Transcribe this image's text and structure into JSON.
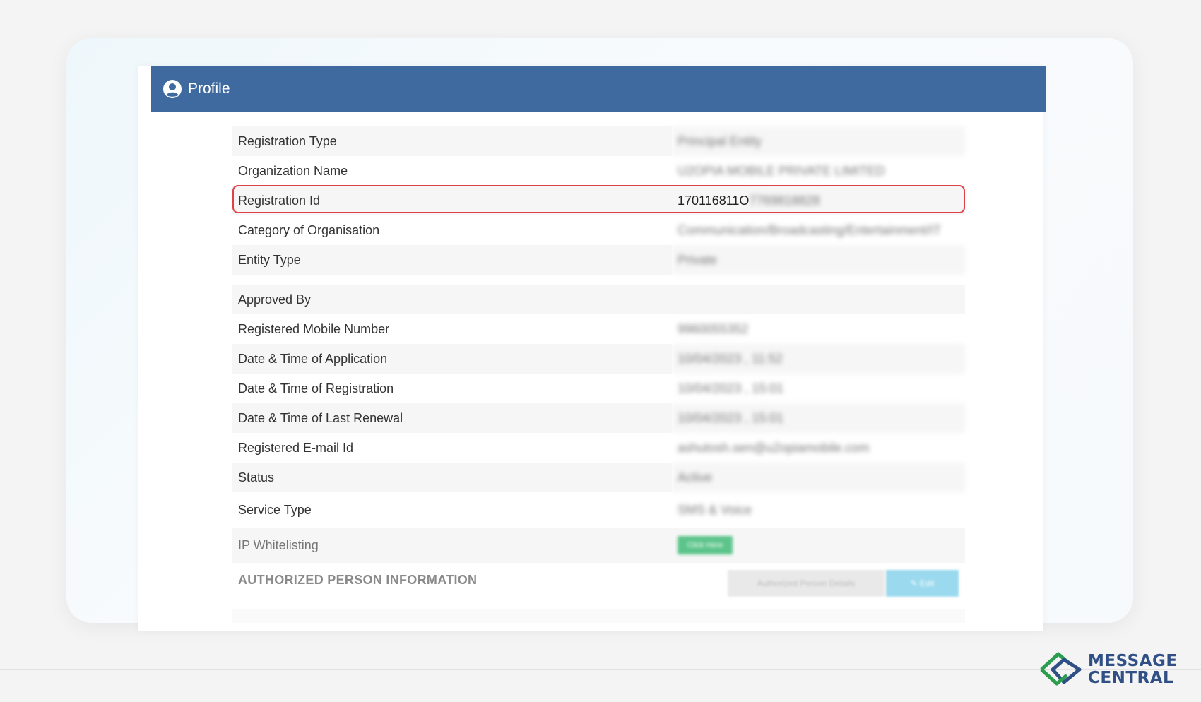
{
  "header": {
    "title": "Profile",
    "icon": "user-circle-icon",
    "color": "#3e6aa0"
  },
  "profile_rows": [
    {
      "label": "Registration Type",
      "value": "Principal Entity",
      "blurred": true
    },
    {
      "label": "Organization Name",
      "value": "U2OPIA MOBILE PRIVATE LIMITED",
      "blurred": true
    },
    {
      "label": "Registration Id",
      "value_visible": "170116811O",
      "value_hidden": "7769818828",
      "highlighted": true
    },
    {
      "label": "Category of Organisation",
      "value": "Communication/Broadcasting/Entertainment/IT",
      "blurred": true
    },
    {
      "label": "Entity Type",
      "value": "Private",
      "blurred": true
    },
    {
      "label": "Approved By",
      "value": ""
    },
    {
      "label": "Registered Mobile Number",
      "value": "9960055352",
      "blurred": true
    },
    {
      "label": "Date & Time of Application",
      "value": "10/04/2023 , 11:52",
      "blurred": true
    },
    {
      "label": "Date & Time of Registration",
      "value": "10/04/2023 , 15:01",
      "blurred": true
    },
    {
      "label": "Date & Time of Last Renewal",
      "value": "10/04/2023 , 15:01",
      "blurred": true
    },
    {
      "label": "Registered E-mail Id",
      "value": "ashutosh.sen@u2opiamobile.com",
      "blurred": true
    },
    {
      "label": "Status",
      "value": "Active",
      "blurred": true
    },
    {
      "label": "Service Type",
      "value": "SMS & Voice",
      "blurred": true
    },
    {
      "label": "IP Whitelisting",
      "value": "Click Here",
      "blurred": true
    }
  ],
  "section": {
    "title": "AUTHORIZED PERSON INFORMATION",
    "grey_button": "Authorized Person Details",
    "edit_button": "Edit"
  },
  "brand": {
    "line1": "MESSAGE",
    "line2": "CENTRAL",
    "logo_icon": "message-central-logo-icon",
    "color": "#2f4f85",
    "logo_green": "#2a9d4e"
  },
  "highlight_color": "#e0404a"
}
